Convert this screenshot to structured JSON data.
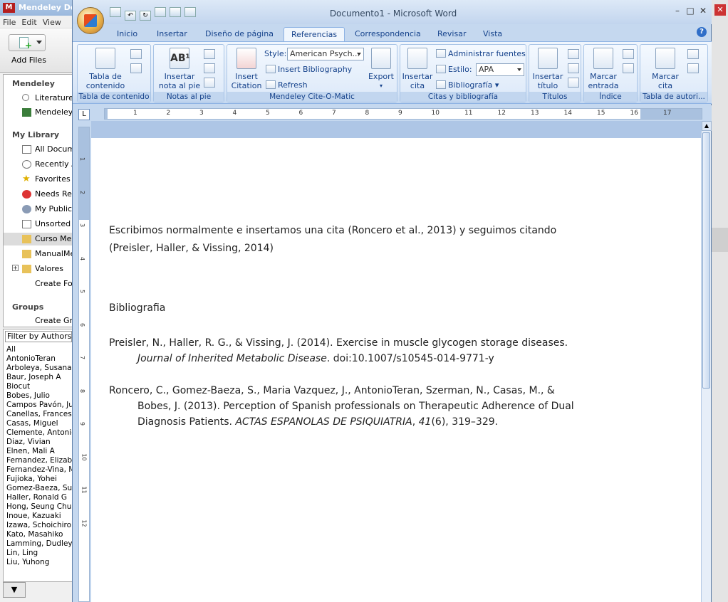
{
  "mendeley": {
    "logo": "M",
    "title": "Mendeley Des",
    "menu": [
      "File",
      "Edit",
      "View"
    ],
    "add_files_label": "Add Files",
    "sections": {
      "mendeley": "Mendeley",
      "my_library": "My Library",
      "groups": "Groups"
    },
    "mendeley_items": [
      "Literature S",
      "Mendeley S"
    ],
    "library_items": [
      "All Docume",
      "Recently A",
      "Favorites",
      "Needs Revi",
      "My Publicat",
      "Unsorted",
      "Curso Men",
      "ManualMen",
      "Valores",
      "Create Fold"
    ],
    "groups_item": "Create Gro",
    "filter_label": "Filter by Authors",
    "authors": [
      "All",
      "AntonioTeran",
      "Arboleya, Susana M",
      "Baur, Joseph A",
      "Biocut",
      "Bobes, Julio",
      "Campos Pavón, Jul",
      "Canellas, Francesca",
      "Casas, Miguel",
      "Clemente, Antonio",
      "Diaz, Vivian",
      "Elnen, Mali A",
      "Fernandez, Elizabe",
      "Fernandez-Vina, M",
      "Fujioka, Yohei",
      "Gomez-Baeza, Susa",
      "Haller, Ronald G",
      "Hong, Seung Chul",
      "Inoue, Kazuaki",
      "Izawa, Schoichiro",
      "Kato, Masahiko",
      "Lamming, Dudley W",
      "Lin, Ling",
      "Liu, Yuhong"
    ]
  },
  "word": {
    "title": "Documento1 - Microsoft Word",
    "tabs": [
      "Inicio",
      "Insertar",
      "Diseño de página",
      "Referencias",
      "Correspondencia",
      "Revisar",
      "Vista"
    ],
    "active_tab": "Referencias",
    "ribbon": {
      "toc": {
        "button": "Tabla de contenido",
        "group": "Tabla de contenido"
      },
      "footnotes": {
        "button": "Insertar nota al pie",
        "group": "Notas al pie"
      },
      "citeomatic": {
        "style_label": "Style:",
        "style_value": "American Psych...",
        "insert_bibliography": "Insert Bibliography",
        "insert_citation": "Insert Citation",
        "refresh": "Refresh",
        "export": "Export",
        "group": "Mendeley Cite-O-Matic"
      },
      "citations": {
        "insert_citation": "Insertar cita",
        "manage_sources": "Administrar fuentes",
        "style_label": "Estilo:",
        "style_value": "APA",
        "bibliography": "Bibliografía",
        "group": "Citas y bibliografía"
      },
      "captions": {
        "button": "Insertar título",
        "group": "Títulos"
      },
      "index": {
        "button": "Marcar entrada",
        "group": "Índice"
      },
      "authorities": {
        "button": "Marcar cita",
        "group": "Tabla de autori..."
      }
    },
    "ruler_numbers": [
      "1",
      "2",
      "3",
      "4",
      "5",
      "6",
      "7",
      "8",
      "9",
      "10",
      "11",
      "12",
      "13",
      "14",
      "15",
      "16",
      "17"
    ],
    "document": {
      "para1_line1": "Escribimos normalmente e insertamos una cita (Roncero et al., 2013) y seguimos citando",
      "para1_line2": "(Preisler, Haller, & Vissing, 2014)",
      "bibliography_heading": "Bibliografia",
      "ref1_line1": "Preisler, N., Haller, R. G., & Vissing, J. (2014). Exercise in muscle glycogen storage diseases.",
      "ref1_journal": "Journal of Inherited Metabolic Disease",
      "ref1_rest": ". doi:10.1007/s10545-014-9771-y",
      "ref2_line1": "Roncero, C., Gomez-Baeza, S., Maria Vazquez, J., AntonioTeran, Szerman, N., Casas, M., &",
      "ref2_line2": "Bobes, J. (2013). Perception of Spanish professionals on Therapeutic Adherence of Dual",
      "ref2_line3_a": "Diagnosis Patients. ",
      "ref2_journal": "ACTAS ESPANOLAS DE PSIQUIATRIA",
      "ref2_sep": ", ",
      "ref2_volume": "41",
      "ref2_pages": "(6), 319–329."
    }
  }
}
